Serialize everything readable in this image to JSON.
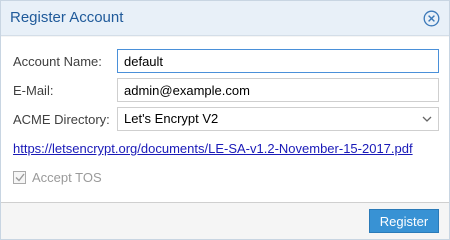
{
  "dialog": {
    "title": "Register Account",
    "close_icon": "close-circle-icon"
  },
  "form": {
    "account_name": {
      "label": "Account Name:",
      "value": "default"
    },
    "email": {
      "label": "E-Mail:",
      "value": "admin@example.com"
    },
    "acme_directory": {
      "label": "ACME Directory:",
      "value": "Let's Encrypt V2",
      "trigger_icon": "chevron-down-icon"
    },
    "tos_link": "https://letsencrypt.org/documents/LE-SA-v1.2-November-15-2017.pdf",
    "accept_tos": {
      "label": "Accept TOS",
      "checked": true,
      "disabled": true
    }
  },
  "footer": {
    "register_label": "Register"
  },
  "colors": {
    "title": "#1f5a9a",
    "accent": "#3892d4",
    "link": "#1a1ab8",
    "focus_border": "#4a90d9"
  }
}
